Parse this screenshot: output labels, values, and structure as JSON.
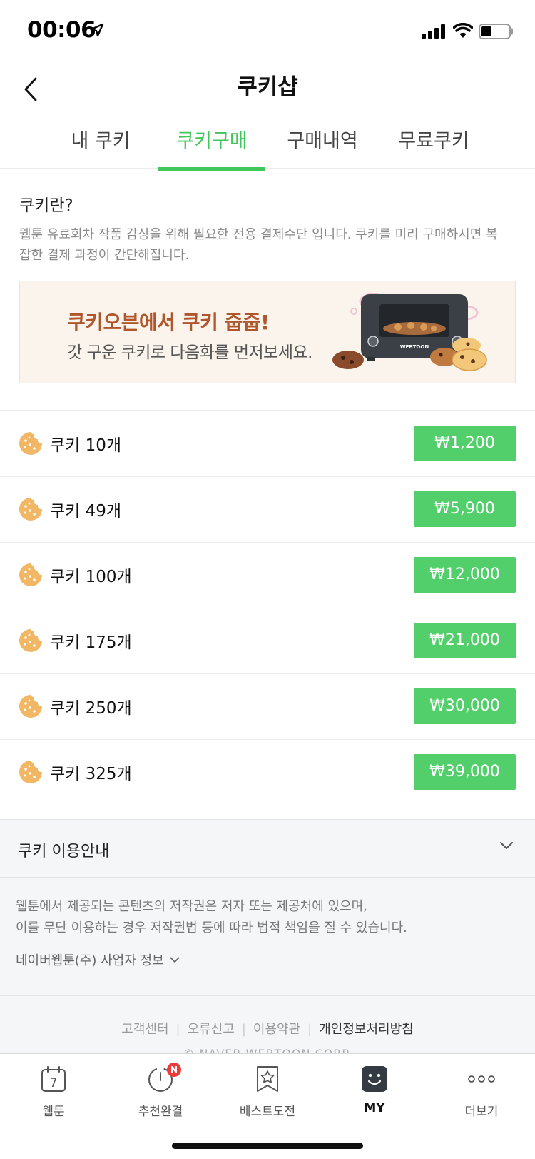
{
  "status_bar": {
    "time": "00:06"
  },
  "header": {
    "title": "쿠키샵"
  },
  "tabs": [
    {
      "label": "내 쿠키",
      "active": false
    },
    {
      "label": "쿠키구매",
      "active": true
    },
    {
      "label": "구매내역",
      "active": false
    },
    {
      "label": "무료쿠키",
      "active": false
    }
  ],
  "info": {
    "title": "쿠키란?",
    "description_line1": "웹툰 유료회차 작품 감상을 위해 필요한 전용 결제수단 입니다. 쿠키를 미리 구매하시면 복",
    "description_line2": "잡한 결제 과정이 간단해집니다."
  },
  "banner": {
    "title": "쿠키오븐에서 쿠키 줍줍!",
    "subtitle": "갓 구운 쿠키로 다음화를 먼저보세요.",
    "oven_logo": "WEBTOON"
  },
  "products": [
    {
      "name": "쿠키 10개",
      "price": "₩1,200"
    },
    {
      "name": "쿠키 49개",
      "price": "₩5,900"
    },
    {
      "name": "쿠키 100개",
      "price": "₩12,000"
    },
    {
      "name": "쿠키 175개",
      "price": "₩21,000"
    },
    {
      "name": "쿠키 250개",
      "price": "₩30,000"
    },
    {
      "name": "쿠키 325개",
      "price": "₩39,000"
    }
  ],
  "guide": {
    "label": "쿠키 이용안내"
  },
  "footer": {
    "notice_line1": "웹툰에서 제공되는 콘텐츠의 저작권은 저자 또는 제공처에 있으며,",
    "notice_line2": "이를 무단 이용하는 경우 저작권법 등에 따라 법적 책임을 질 수 있습니다.",
    "business_info": "네이버웹툰(주) 사업자 정보",
    "links": [
      "고객센터",
      "오류신고",
      "이용약관",
      "개인정보처리방침"
    ],
    "corp": "© NAVER WEBTOON CORP."
  },
  "tabbar": {
    "calendar_day": "7",
    "badge": "N",
    "items": [
      {
        "label": "웹툰",
        "icon": "calendar-icon"
      },
      {
        "label": "추천완결",
        "icon": "timer-icon"
      },
      {
        "label": "베스트도전",
        "icon": "bookmark-star-icon"
      },
      {
        "label": "MY",
        "icon": "smile-icon",
        "active": true
      },
      {
        "label": "더보기",
        "icon": "more-icon"
      }
    ]
  },
  "colors": {
    "accent": "#40c65a",
    "price_button": "#52cf6b",
    "banner_title": "#b0562c",
    "cookie": "#f2b764",
    "badge": "#ef3a3a"
  }
}
